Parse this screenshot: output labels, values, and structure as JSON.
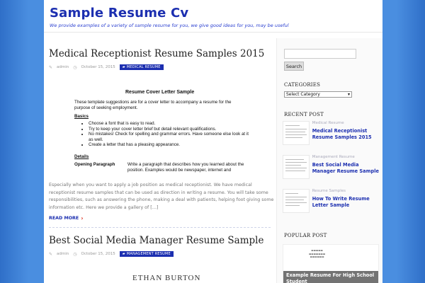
{
  "site": {
    "title": "Sample Resume Cv",
    "tagline": "We provide examples of a variety of sample resume for you, we give good ideas for you, may be useful"
  },
  "posts": [
    {
      "title": "Medical Receptionist Resume Samples 2015",
      "author": "admin",
      "date": "October 15, 2015",
      "category": "MEDICAL RESUME",
      "thumb": {
        "doc_title": "Resume Cover Letter Sample",
        "intro": "These template suggestions are for a cover letter to accompany a resume for the purpose of seeking employment.",
        "basics": "Basics",
        "bullets": [
          "Choose a font that is easy to read.",
          "Try to keep your cover letter brief but detail relevant qualifications.",
          "No mistakes!  Check for spelling and grammar errors.  Have someone else look at it as well.",
          "Create a letter that has a pleasing appearance."
        ],
        "details": "Details",
        "opening": "Opening Paragraph",
        "opening_text": "Write a paragraph that describes how you learned about the position. Examples would be newspaper, internet and"
      },
      "excerpt": "Especially when you want to apply a job position as medical receptionist. We have medical receptionist resume samples that can be used as direction in writing a resume. You will take some responsibilities, such as answering the phone, making a deal with patients, helping foot giving some information etc. Here we provide a gallery of […]",
      "read_more": "READ MORE"
    },
    {
      "title": "Best Social Media Manager Resume Sample",
      "author": "admin",
      "date": "October 15, 2015",
      "category": "MANAGEMENT RESUME",
      "thumb_name": "ETHAN BURTON"
    }
  ],
  "sidebar": {
    "search_button": "Search",
    "categories_title": "CATEGORIES",
    "categories_select": "Select Category",
    "recent_title": "RECENT POST",
    "recent": [
      {
        "category": "Medical Resume",
        "title": "Medical Receptionist Resume Samples 2015"
      },
      {
        "category": "Management Resume",
        "title": "Best Social Media Manager Resume Sample"
      },
      {
        "category": "Resume Samples",
        "title": "How To Write Resume Letter Sample"
      }
    ],
    "popular_title": "POPULAR POST",
    "popular": {
      "caption": "Example Resume For High School Student"
    }
  }
}
